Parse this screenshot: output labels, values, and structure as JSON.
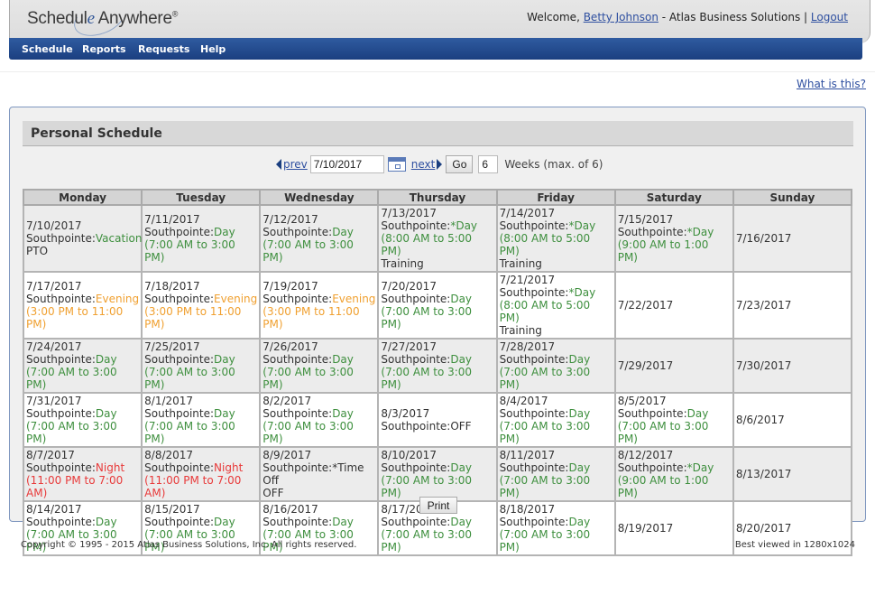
{
  "header": {
    "logo": {
      "part1": "Schedul",
      "part2": "e",
      "part3": " Anywhere",
      "reg": "®"
    },
    "welcome_prefix": "Welcome, ",
    "user_name": "Betty Johnson",
    "company_sep": " - Atlas Business Solutions | ",
    "logout": "Logout"
  },
  "nav": {
    "items": [
      {
        "label": "Schedule"
      },
      {
        "label": "Reports"
      },
      {
        "label": "Requests"
      },
      {
        "label": "Help"
      }
    ]
  },
  "help_link": "What is this?",
  "panel": {
    "title": "Personal Schedule",
    "controls": {
      "prev": "prev",
      "date_value": "7/10/2017",
      "next": "next",
      "go": "Go",
      "weeks_value": "6",
      "weeks_label": "Weeks (max. of 6)"
    },
    "days": [
      "Monday",
      "Tuesday",
      "Wednesday",
      "Thursday",
      "Friday",
      "Saturday",
      "Sunday"
    ],
    "weeks": [
      [
        {
          "date": "7/10/2017",
          "loc": "Southpointe:",
          "shift": "Vacation",
          "color": "green",
          "time": "",
          "note": "PTO"
        },
        {
          "date": "7/11/2017",
          "loc": "Southpointe:",
          "shift": "Day",
          "color": "green",
          "time": "(7:00 AM to 3:00 PM)",
          "note": ""
        },
        {
          "date": "7/12/2017",
          "loc": "Southpointe:",
          "shift": "Day",
          "color": "green",
          "time": "(7:00 AM to 3:00 PM)",
          "note": ""
        },
        {
          "date": "7/13/2017",
          "loc": "Southpointe:",
          "shift": "*Day",
          "color": "green",
          "time": "(8:00 AM to 5:00 PM)",
          "note": "Training"
        },
        {
          "date": "7/14/2017",
          "loc": "Southpointe:",
          "shift": "*Day",
          "color": "green",
          "time": "(8:00 AM to 5:00 PM)",
          "note": "Training"
        },
        {
          "date": "7/15/2017",
          "loc": "Southpointe:",
          "shift": "*Day",
          "color": "green",
          "time": "(9:00 AM to 1:00 PM)",
          "note": ""
        },
        {
          "date": "7/16/2017",
          "loc": "",
          "shift": "",
          "color": "",
          "time": "",
          "note": ""
        }
      ],
      [
        {
          "date": "7/17/2017",
          "loc": "Southpointe:",
          "shift": "Evening",
          "color": "orange",
          "time": "(3:00 PM to 11:00 PM)",
          "note": ""
        },
        {
          "date": "7/18/2017",
          "loc": "Southpointe:",
          "shift": "Evening",
          "color": "orange",
          "time": "(3:00 PM to 11:00 PM)",
          "note": ""
        },
        {
          "date": "7/19/2017",
          "loc": "Southpointe:",
          "shift": "Evening",
          "color": "orange",
          "time": "(3:00 PM to 11:00 PM)",
          "note": ""
        },
        {
          "date": "7/20/2017",
          "loc": "Southpointe:",
          "shift": "Day",
          "color": "green",
          "time": "(7:00 AM to 3:00 PM)",
          "note": ""
        },
        {
          "date": "7/21/2017",
          "loc": "Southpointe:",
          "shift": "*Day",
          "color": "green",
          "time": "(8:00 AM to 5:00 PM)",
          "note": "Training"
        },
        {
          "date": "7/22/2017",
          "loc": "",
          "shift": "",
          "color": "",
          "time": "",
          "note": ""
        },
        {
          "date": "7/23/2017",
          "loc": "",
          "shift": "",
          "color": "",
          "time": "",
          "note": ""
        }
      ],
      [
        {
          "date": "7/24/2017",
          "loc": "Southpointe:",
          "shift": "Day",
          "color": "green",
          "time": "(7:00 AM to 3:00 PM)",
          "note": ""
        },
        {
          "date": "7/25/2017",
          "loc": "Southpointe:",
          "shift": "Day",
          "color": "green",
          "time": "(7:00 AM to 3:00 PM)",
          "note": ""
        },
        {
          "date": "7/26/2017",
          "loc": "Southpointe:",
          "shift": "Day",
          "color": "green",
          "time": "(7:00 AM to 3:00 PM)",
          "note": ""
        },
        {
          "date": "7/27/2017",
          "loc": "Southpointe:",
          "shift": "Day",
          "color": "green",
          "time": "(7:00 AM to 3:00 PM)",
          "note": ""
        },
        {
          "date": "7/28/2017",
          "loc": "Southpointe:",
          "shift": "Day",
          "color": "green",
          "time": "(7:00 AM to 3:00 PM)",
          "note": ""
        },
        {
          "date": "7/29/2017",
          "loc": "",
          "shift": "",
          "color": "",
          "time": "",
          "note": ""
        },
        {
          "date": "7/30/2017",
          "loc": "",
          "shift": "",
          "color": "",
          "time": "",
          "note": ""
        }
      ],
      [
        {
          "date": "7/31/2017",
          "loc": "Southpointe:",
          "shift": "Day",
          "color": "green",
          "time": "(7:00 AM to 3:00 PM)",
          "note": ""
        },
        {
          "date": "8/1/2017",
          "loc": "Southpointe:",
          "shift": "Day",
          "color": "green",
          "time": "(7:00 AM to 3:00 PM)",
          "note": ""
        },
        {
          "date": "8/2/2017",
          "loc": "Southpointe:",
          "shift": "Day",
          "color": "green",
          "time": "(7:00 AM to 3:00 PM)",
          "note": ""
        },
        {
          "date": "8/3/2017",
          "loc": "Southpointe:",
          "shift": "OFF",
          "color": "plain",
          "time": "",
          "note": ""
        },
        {
          "date": "8/4/2017",
          "loc": "Southpointe:",
          "shift": "Day",
          "color": "green",
          "time": "(7:00 AM to 3:00 PM)",
          "note": ""
        },
        {
          "date": "8/5/2017",
          "loc": "Southpointe:",
          "shift": "Day",
          "color": "green",
          "time": "(7:00 AM to 3:00 PM)",
          "note": ""
        },
        {
          "date": "8/6/2017",
          "loc": "",
          "shift": "",
          "color": "",
          "time": "",
          "note": ""
        }
      ],
      [
        {
          "date": "8/7/2017",
          "loc": "Southpointe:",
          "shift": "Night",
          "color": "red",
          "time": "(11:00 PM to 7:00 AM)",
          "note": ""
        },
        {
          "date": "8/8/2017",
          "loc": "Southpointe:",
          "shift": "Night",
          "color": "red",
          "time": "(11:00 PM to 7:00 AM)",
          "note": ""
        },
        {
          "date": "8/9/2017",
          "loc": "Southpointe:",
          "shift": "*Time Off",
          "color": "plain",
          "time": "",
          "note": "OFF"
        },
        {
          "date": "8/10/2017",
          "loc": "Southpointe:",
          "shift": "Day",
          "color": "green",
          "time": "(7:00 AM to 3:00 PM)",
          "note": ""
        },
        {
          "date": "8/11/2017",
          "loc": "Southpointe:",
          "shift": "Day",
          "color": "green",
          "time": "(7:00 AM to 3:00 PM)",
          "note": ""
        },
        {
          "date": "8/12/2017",
          "loc": "Southpointe:",
          "shift": "*Day",
          "color": "green",
          "time": "(9:00 AM to 1:00 PM)",
          "note": ""
        },
        {
          "date": "8/13/2017",
          "loc": "",
          "shift": "",
          "color": "",
          "time": "",
          "note": ""
        }
      ],
      [
        {
          "date": "8/14/2017",
          "loc": "Southpointe:",
          "shift": "Day",
          "color": "green",
          "time": "(7:00 AM to 3:00 PM)",
          "note": ""
        },
        {
          "date": "8/15/2017",
          "loc": "Southpointe:",
          "shift": "Day",
          "color": "green",
          "time": "(7:00 AM to 3:00 PM)",
          "note": ""
        },
        {
          "date": "8/16/2017",
          "loc": "Southpointe:",
          "shift": "Day",
          "color": "green",
          "time": "(7:00 AM to 3:00 PM)",
          "note": ""
        },
        {
          "date": "8/17/2017",
          "loc": "Southpointe:",
          "shift": "Day",
          "color": "green",
          "time": "(7:00 AM to 3:00 PM)",
          "note": ""
        },
        {
          "date": "8/18/2017",
          "loc": "Southpointe:",
          "shift": "Day",
          "color": "green",
          "time": "(7:00 AM to 3:00 PM)",
          "note": ""
        },
        {
          "date": "8/19/2017",
          "loc": "",
          "shift": "",
          "color": "",
          "time": "",
          "note": ""
        },
        {
          "date": "8/20/2017",
          "loc": "",
          "shift": "",
          "color": "",
          "time": "",
          "note": ""
        }
      ]
    ],
    "print": "Print"
  },
  "colors": {
    "day": "#3e8f3e",
    "evening": "#f0a030",
    "night": "#e83a3a",
    "nav": "#1b3f80",
    "link": "#2e4fa0"
  },
  "footer": {
    "copyright": "Copyright © 1995 - 2015 Atlas Business Solutions, Inc. All rights reserved.",
    "best_viewed": "Best viewed in 1280x1024"
  }
}
